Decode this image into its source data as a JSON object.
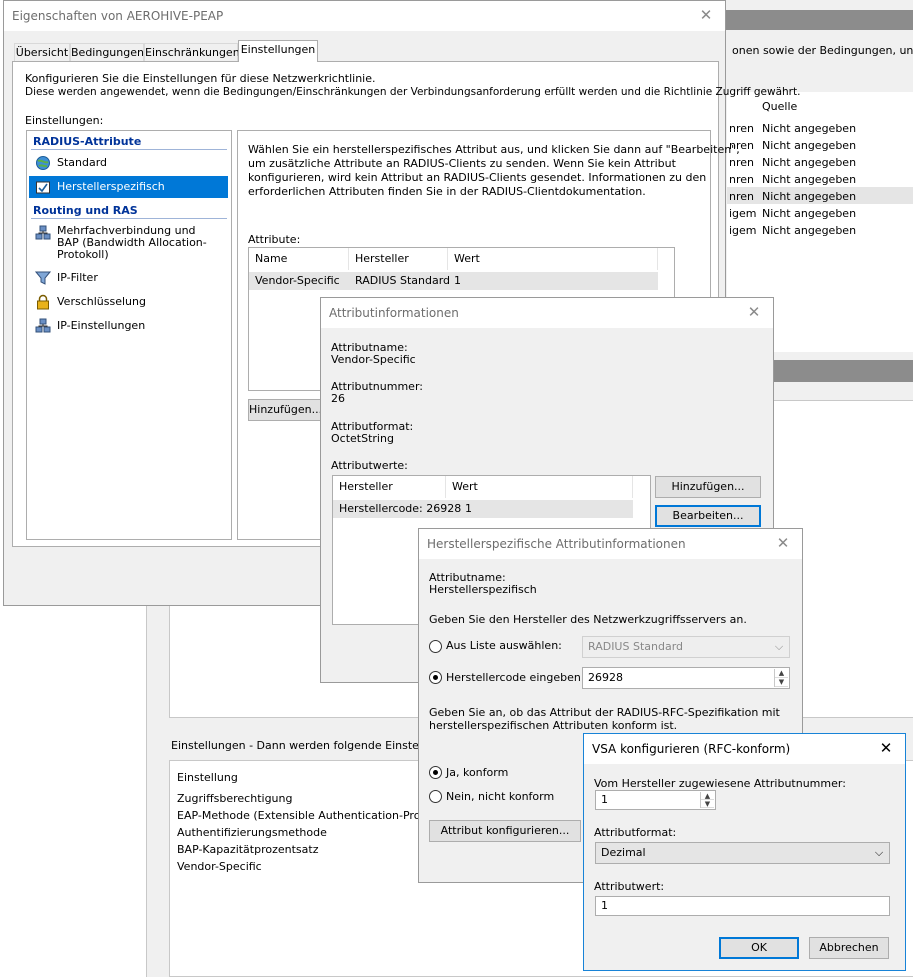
{
  "main": {
    "title": "Eigenschaften von AEROHIVE-PEAP",
    "tabs": [
      "Übersicht",
      "Bedingungen",
      "Einschränkungen",
      "Einstellungen"
    ],
    "intro_line1": "Konfigurieren Sie die Einstellungen für diese Netzwerkrichtlinie.",
    "intro_line2": "Diese werden angewendet, wenn die Bedingungen/Einschränkungen der Verbindungsanforderung erfüllt werden und die Richtlinie Zugriff gewährt.",
    "settings_label": "Einstellungen:",
    "nav": {
      "group1": "RADIUS-Attribute",
      "standard": "Standard",
      "vendor": "Herstellerspezifisch",
      "group2": "Routing und RAS",
      "multilink_1": "Mehrfachverbindung und",
      "multilink_2": "BAP (Bandwidth Allocation-",
      "multilink_3": "Protokoll)",
      "ipfilter": "IP-Filter",
      "encryption": "Verschlüsselung",
      "ipsettings": "IP-Einstellungen"
    },
    "desc_1": "Wählen Sie ein herstellerspezifisches Attribut aus, und klicken Sie dann auf \"Bearbeiten\",",
    "desc_2": "um zusätzliche Attribute an RADIUS-Clients zu senden. Wenn Sie kein Attribut",
    "desc_3": "konfigurieren, wird kein Attribut an RADIUS-Clients gesendet. Informationen zu den",
    "desc_4": "erforderlichen Attributen finden Sie in der RADIUS-Clientdokumentation.",
    "attr_label": "Attribute:",
    "attr_headers": [
      "Name",
      "Hersteller",
      "Wert"
    ],
    "attr_row": [
      "Vendor-Specific",
      "RADIUS Standard",
      "1"
    ],
    "add_button": "Hinzufügen..."
  },
  "background": {
    "top_text": "onen sowie der Bedingungen, unter den",
    "quelle_header": "Quelle",
    "left_fragments": [
      "nren",
      "nren",
      "nren",
      "nren",
      "nren",
      "igem",
      "igem"
    ],
    "quelle_values": [
      "Nicht angegeben",
      "Nicht angegeben",
      "Nicht angegeben",
      "Nicht angegeben",
      "Nicht angegeben",
      "Nicht angegeben",
      "Nicht angegeben"
    ],
    "settings_header": "Einstellungen - Dann werden folgende Einstellungen",
    "settings_list_header": "Einstellung",
    "settings_list": [
      "Zugriffsberechtigung",
      "EAP-Methode (Extensible Authentication-Protokoll)",
      "Authentifizierungsmethode",
      "BAP-Kapazitätprozentsatz",
      "Vendor-Specific"
    ]
  },
  "attrinfo": {
    "title": "Attributinformationen",
    "name_label": "Attributname:",
    "name_value": "Vendor-Specific",
    "number_label": "Attributnummer:",
    "number_value": "26",
    "format_label": "Attributformat:",
    "format_value": "OctetString",
    "values_label": "Attributwerte:",
    "table_headers": [
      "Hersteller",
      "Wert"
    ],
    "table_row": [
      "Herstellercode: 26928",
      "1"
    ],
    "add_button": "Hinzufügen...",
    "edit_button": "Bearbeiten..."
  },
  "vendorinfo": {
    "title": "Herstellerspezifische Attributinformationen",
    "name_label": "Attributname:",
    "name_value": "Herstellerspezifisch",
    "vendor_prompt": "Geben Sie den Hersteller des Netzwerkzugriffsservers an.",
    "radio_list": "Aus Liste auswählen:",
    "list_value": "RADIUS Standard",
    "radio_code": "Herstellercode eingeben:",
    "code_value": "26928",
    "rfc_prompt_1": "Geben Sie an, ob das Attribut der RADIUS-RFC-Spezifikation mit",
    "rfc_prompt_2": "herstellerspezifischen Attributen konform ist.",
    "radio_yes": "Ja, konform",
    "radio_no": "Nein, nicht konform",
    "configure_button": "Attribut konfigurieren..."
  },
  "vsa": {
    "title": "VSA konfigurieren (RFC-konform)",
    "number_label": "Vom Hersteller zugewiesene Attributnummer:",
    "number_value": "1",
    "format_label": "Attributformat:",
    "format_value": "Dezimal",
    "value_label": "Attributwert:",
    "value_value": "1",
    "ok_button": "OK",
    "cancel_button": "Abbrechen"
  }
}
